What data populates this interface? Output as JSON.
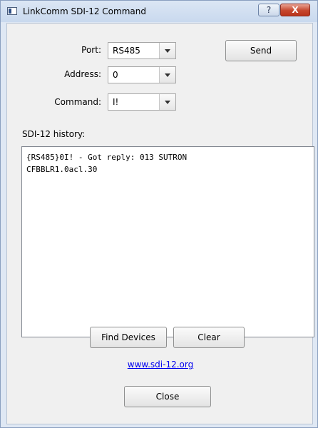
{
  "window": {
    "title": "LinkComm SDI-12 Command",
    "help_label": "?",
    "close_label": "X"
  },
  "form": {
    "port_label": "Port:",
    "port_value": "RS485",
    "address_label": "Address:",
    "address_value": "0",
    "command_label": "Command:",
    "command_value": "I!",
    "send_label": "Send"
  },
  "history": {
    "label": "SDI-12 history:",
    "lines": [
      "{RS485}0I! - Got reply: 013 SUTRON",
      "CFBBLR1.0acl.30"
    ]
  },
  "buttons": {
    "find_devices": "Find Devices",
    "clear": "Clear",
    "close": "Close"
  },
  "link": {
    "text": "www.sdi-12.org"
  }
}
